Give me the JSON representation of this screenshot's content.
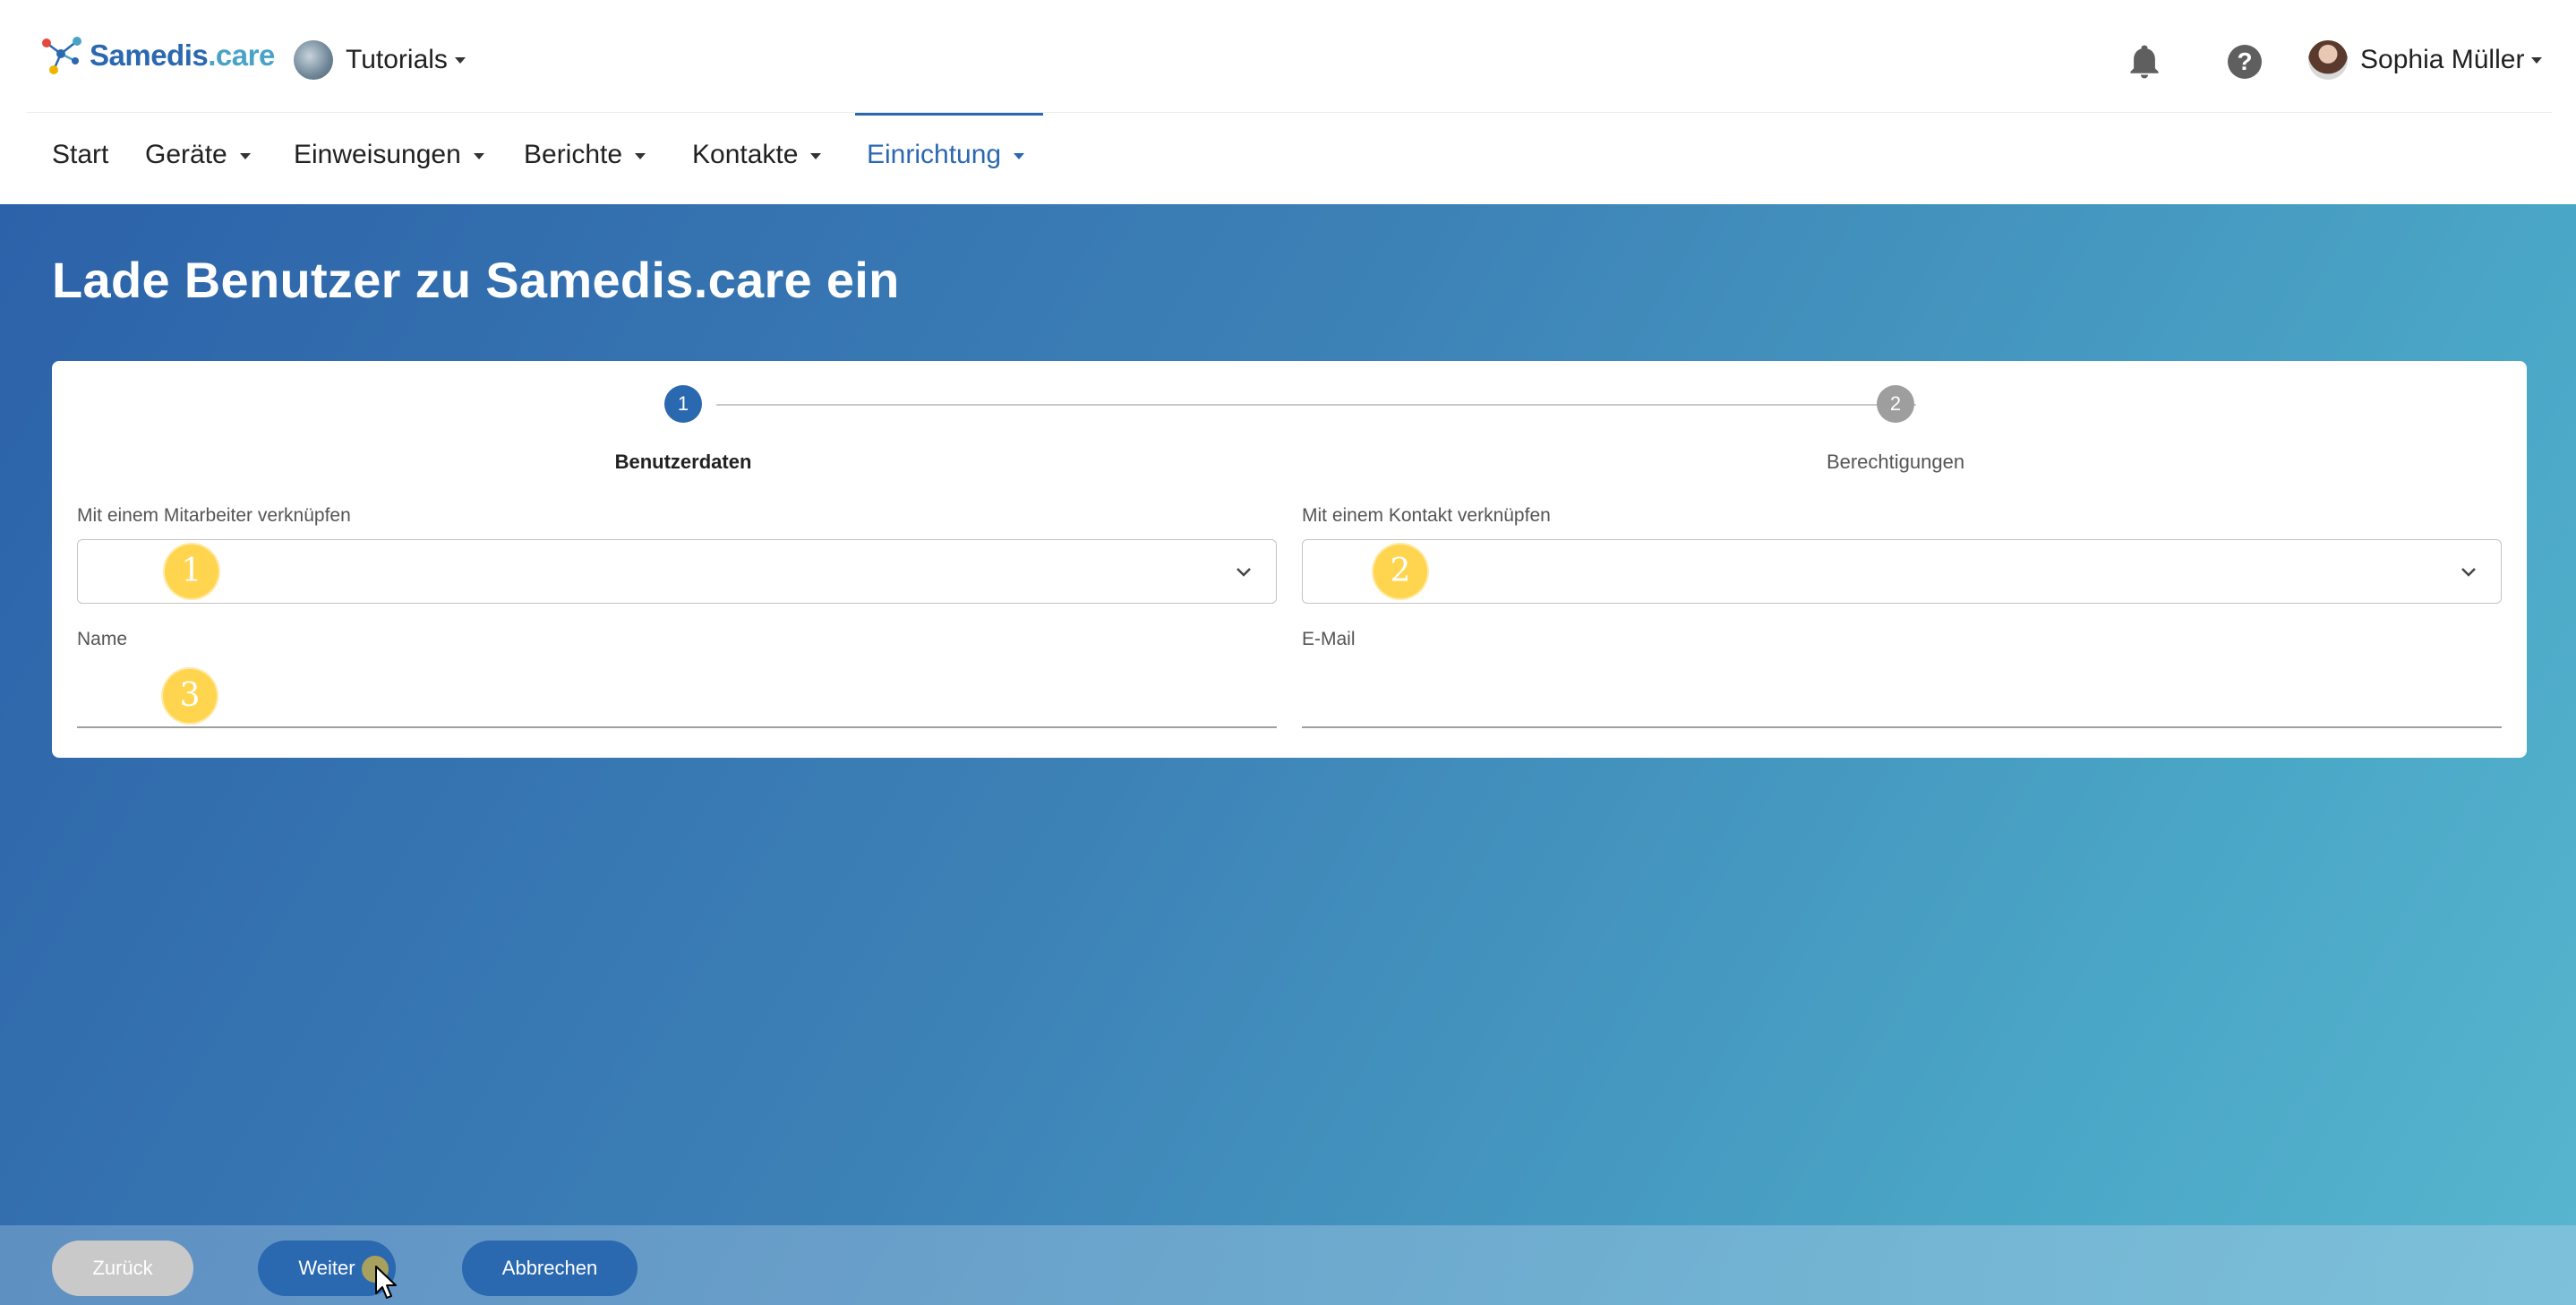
{
  "brand": {
    "name_part1": "Samedis",
    "name_part2": ".care"
  },
  "tenant": {
    "label": "Tutorials"
  },
  "user": {
    "name": "Sophia Müller"
  },
  "nav": {
    "items": [
      {
        "label": "Start"
      },
      {
        "label": "Geräte"
      },
      {
        "label": "Einweisungen"
      },
      {
        "label": "Berichte"
      },
      {
        "label": "Kontakte"
      },
      {
        "label": "Einrichtung"
      }
    ],
    "active": "Einrichtung"
  },
  "page": {
    "title": "Lade Benutzer zu Samedis.care ein"
  },
  "stepper": {
    "steps": [
      {
        "number": "1",
        "label": "Benutzerdaten",
        "state": "active"
      },
      {
        "number": "2",
        "label": "Berechtigungen",
        "state": "inactive"
      }
    ]
  },
  "form": {
    "employee": {
      "label": "Mit einem Mitarbeiter verknüpfen",
      "value": ""
    },
    "contact": {
      "label": "Mit einem Kontakt verknüpfen",
      "value": ""
    },
    "name": {
      "label": "Name",
      "value": ""
    },
    "email": {
      "label": "E-Mail",
      "value": ""
    }
  },
  "annotations": [
    "1",
    "2",
    "3"
  ],
  "buttons": {
    "back": "Zurück",
    "next": "Weiter",
    "cancel": "Abbrechen"
  },
  "icons": {
    "bell": "bell-icon",
    "help": "help-icon",
    "chevron": "chevron-down-icon",
    "logo": "molecule-logo-icon",
    "cursor": "mouse-pointer-icon"
  },
  "colors": {
    "primary": "#2a68b0",
    "accent": "#49a3c6",
    "annotation": "#ffd54f",
    "disabled": "#c9c9c9"
  }
}
